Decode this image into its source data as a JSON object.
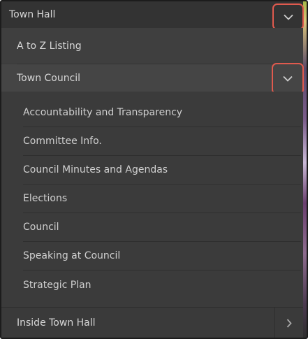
{
  "header": {
    "title": "Town Hall",
    "toggle_icon": "chevron-down-icon"
  },
  "menu": {
    "a_to_z": "A to Z Listing",
    "town_council": {
      "label": "Town Council",
      "toggle_icon": "chevron-down-icon"
    },
    "council_items": [
      "Accountability and Transparency",
      "Committee Info.",
      "Council Minutes and Agendas",
      "Elections",
      "Council",
      "Speaking at Council",
      "Strategic Plan"
    ],
    "inside_town_hall": {
      "label": "Inside Town Hall",
      "arrow_icon": "chevron-right-icon"
    }
  },
  "colors": {
    "panel_bg": "#3a3a3a",
    "text": "#d6d6d6",
    "highlight_outline": "#e05a4e"
  }
}
